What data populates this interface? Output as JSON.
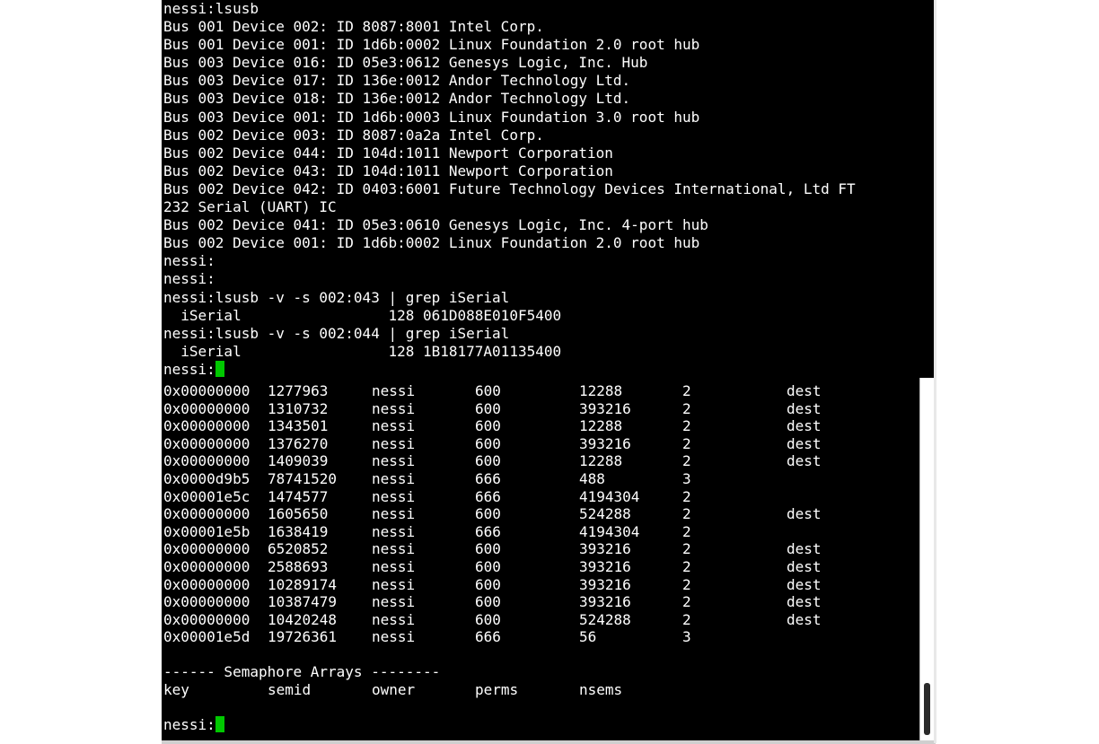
{
  "front_terminal": {
    "lines": [
      "nessi:lsusb",
      "Bus 001 Device 002: ID 8087:8001 Intel Corp.",
      "Bus 001 Device 001: ID 1d6b:0002 Linux Foundation 2.0 root hub",
      "Bus 003 Device 016: ID 05e3:0612 Genesys Logic, Inc. Hub",
      "Bus 003 Device 017: ID 136e:0012 Andor Technology Ltd.",
      "Bus 003 Device 018: ID 136e:0012 Andor Technology Ltd.",
      "Bus 003 Device 001: ID 1d6b:0003 Linux Foundation 3.0 root hub",
      "Bus 002 Device 003: ID 8087:0a2a Intel Corp.",
      "Bus 002 Device 044: ID 104d:1011 Newport Corporation",
      "Bus 002 Device 043: ID 104d:1011 Newport Corporation",
      "Bus 002 Device 042: ID 0403:6001 Future Technology Devices International, Ltd FT",
      "232 Serial (UART) IC",
      "Bus 002 Device 041: ID 05e3:0610 Genesys Logic, Inc. 4-port hub",
      "Bus 002 Device 001: ID 1d6b:0002 Linux Foundation 2.0 root hub",
      "nessi:",
      "nessi:",
      "nessi:lsusb -v -s 002:043 | grep iSerial",
      "  iSerial                 128 061D088E010F5400",
      "nessi:lsusb -v -s 002:044 | grep iSerial",
      "  iSerial                 128 1B18177A01135400"
    ],
    "prompt": "nessi:"
  },
  "back_terminal": {
    "rows": [
      [
        "0x00000000",
        "1277963",
        "nessi",
        "600",
        "12288",
        "2",
        "dest"
      ],
      [
        "0x00000000",
        "1310732",
        "nessi",
        "600",
        "393216",
        "2",
        "dest"
      ],
      [
        "0x00000000",
        "1343501",
        "nessi",
        "600",
        "12288",
        "2",
        "dest"
      ],
      [
        "0x00000000",
        "1376270",
        "nessi",
        "600",
        "393216",
        "2",
        "dest"
      ],
      [
        "0x00000000",
        "1409039",
        "nessi",
        "600",
        "12288",
        "2",
        "dest"
      ],
      [
        "0x0000d9b5",
        "78741520",
        "nessi",
        "666",
        "488",
        "3",
        ""
      ],
      [
        "0x00001e5c",
        "1474577",
        "nessi",
        "666",
        "4194304",
        "2",
        ""
      ],
      [
        "0x00000000",
        "1605650",
        "nessi",
        "600",
        "524288",
        "2",
        "dest"
      ],
      [
        "0x00001e5b",
        "1638419",
        "nessi",
        "666",
        "4194304",
        "2",
        ""
      ],
      [
        "0x00000000",
        "6520852",
        "nessi",
        "600",
        "393216",
        "2",
        "dest"
      ],
      [
        "0x00000000",
        "2588693",
        "nessi",
        "600",
        "393216",
        "2",
        "dest"
      ],
      [
        "0x00000000",
        "10289174",
        "nessi",
        "600",
        "393216",
        "2",
        "dest"
      ],
      [
        "0x00000000",
        "10387479",
        "nessi",
        "600",
        "393216",
        "2",
        "dest"
      ],
      [
        "0x00000000",
        "10420248",
        "nessi",
        "600",
        "524288",
        "2",
        "dest"
      ],
      [
        "0x00001e5d",
        "19726361",
        "nessi",
        "666",
        "56",
        "3",
        ""
      ]
    ],
    "semaphore_heading": "------ Semaphore Arrays --------",
    "semaphore_headers": [
      "key",
      "semid",
      "owner",
      "perms",
      "nsems"
    ],
    "prompt": "nessi:",
    "cursor_color": "#00c800"
  }
}
